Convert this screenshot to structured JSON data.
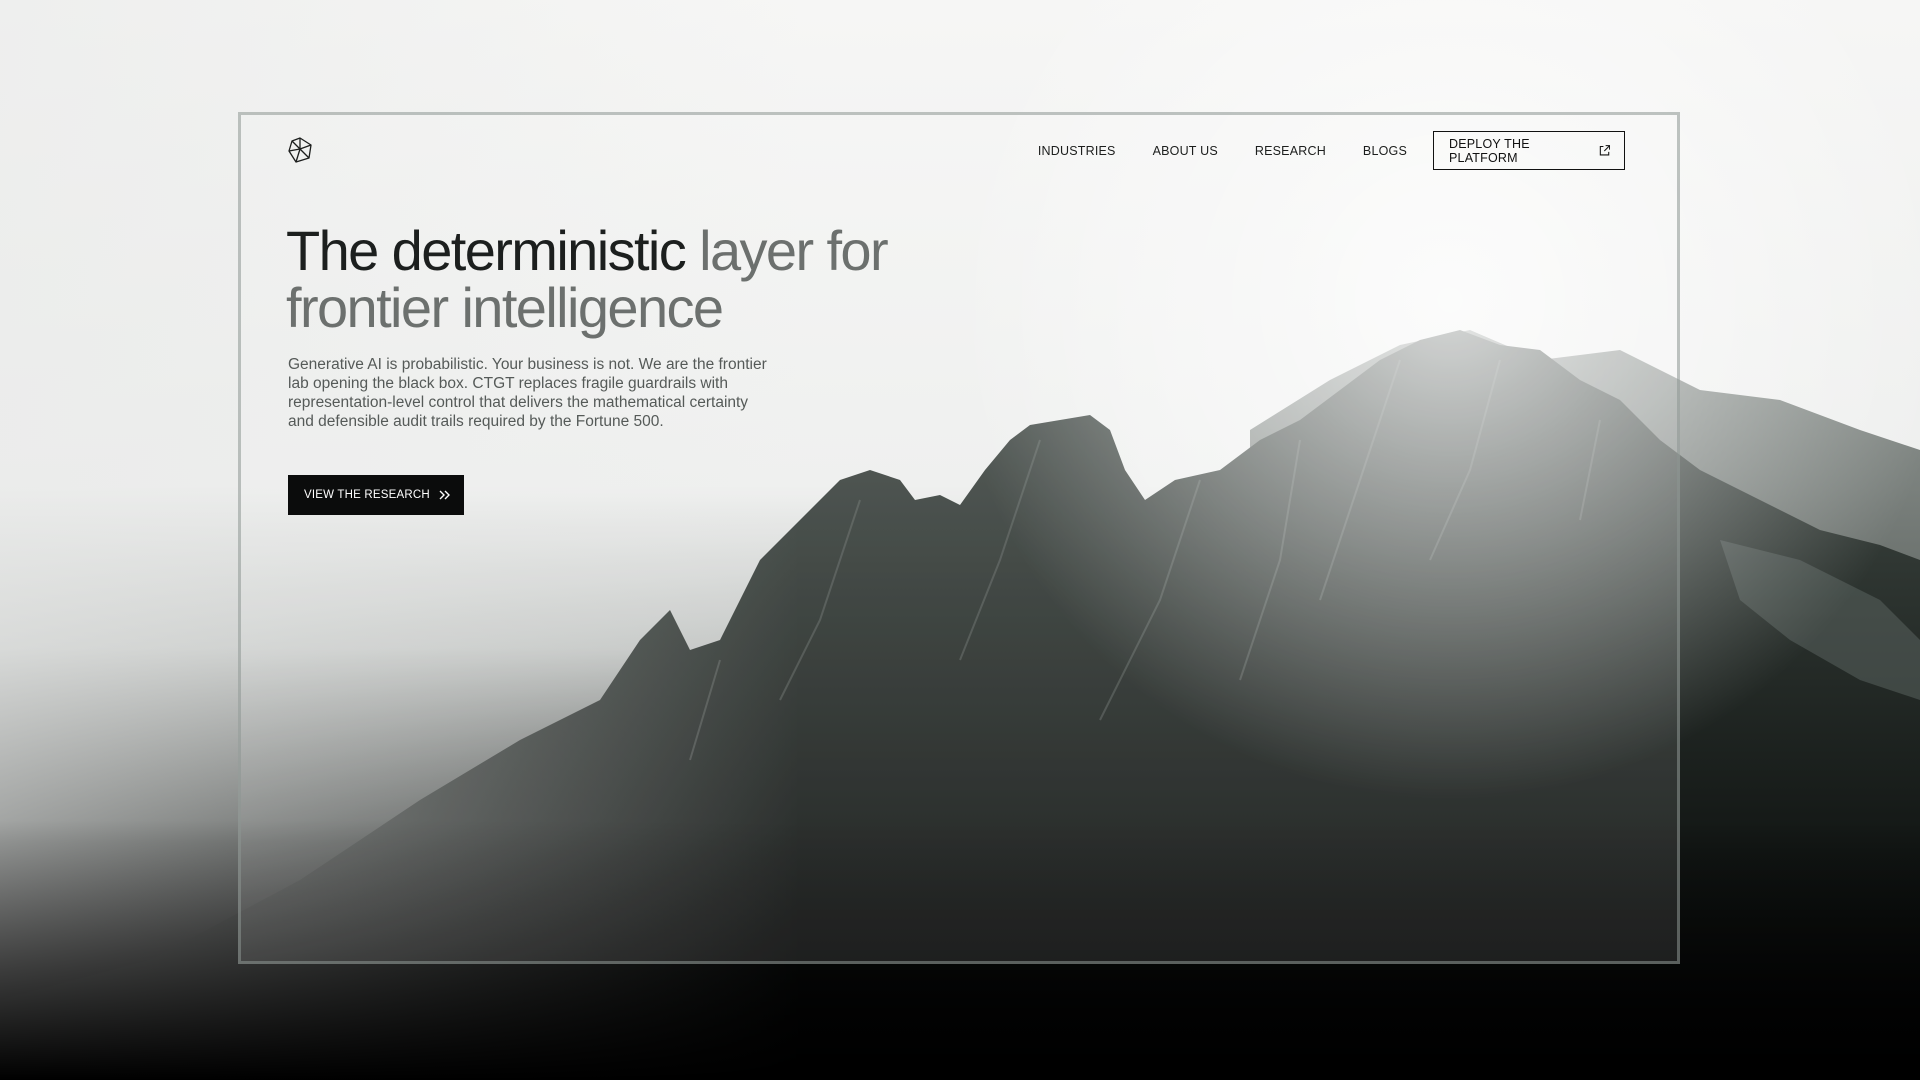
{
  "nav": {
    "items": [
      {
        "label": "INDUSTRIES"
      },
      {
        "label": "ABOUT US"
      },
      {
        "label": "RESEARCH"
      },
      {
        "label": "BLOGS"
      }
    ],
    "deploy_label": "DEPLOY THE PLATFORM",
    "deploy_icon": "external-link-icon"
  },
  "hero": {
    "title_dark": "The deterministic",
    "title_muted": "layer for frontier intelligence",
    "description": "Generative AI is probabilistic. Your business is not. We are the frontier lab opening the black box. CTGT replaces fragile guardrails with representation-level control that delivers the mathematical certainty and defensible audit trails required by the Fortune 500.",
    "cta_label": "VIEW THE RESEARCH",
    "cta_icon": "double-chevron-right-icon"
  },
  "colors": {
    "text_dark": "#1c1f1e",
    "text_muted": "#6c706e",
    "button_bg": "#0b0c0c"
  }
}
